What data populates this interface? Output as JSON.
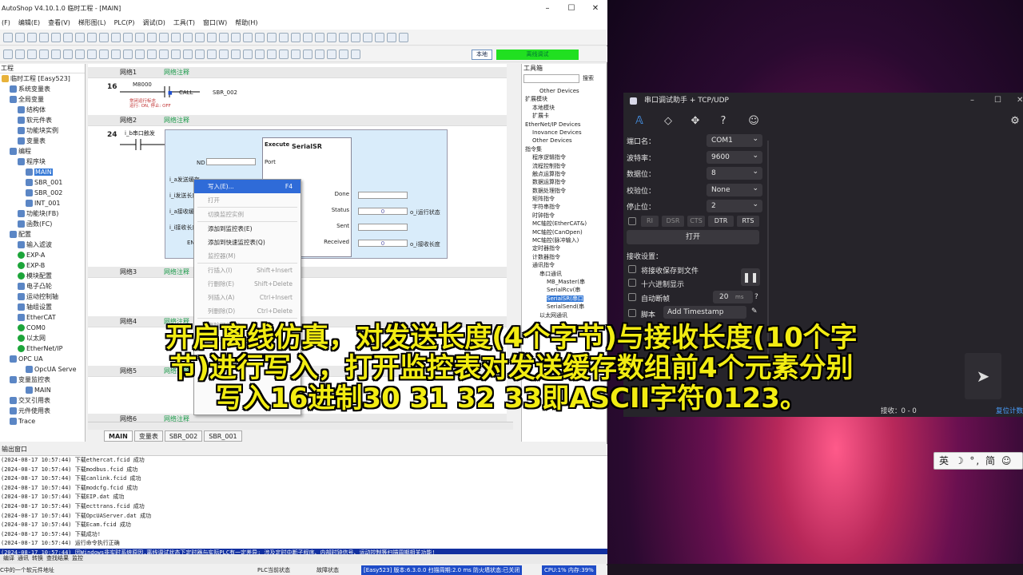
{
  "app": {
    "title": "AutoShop V4.10.1.0 临时工程 - [MAIN]",
    "min": "–",
    "max": "☐",
    "close": "✕"
  },
  "menu": [
    "(F)",
    "编辑(E)",
    "查看(V)",
    "梯形图(L)",
    "PLC(P)",
    "调试(D)",
    "工具(T)",
    "窗口(W)",
    "帮助(H)"
  ],
  "toolbar": {
    "local": "本地",
    "offline": "离线调试"
  },
  "tree": {
    "header": "工程",
    "items": [
      {
        "label": "临时工程 [Easy523]",
        "d": 0,
        "ic": "y"
      },
      {
        "label": "系统变量表",
        "d": 1,
        "ic": "b"
      },
      {
        "label": "全局变量",
        "d": 1,
        "ic": "b"
      },
      {
        "label": "结构体",
        "d": 2,
        "ic": "b"
      },
      {
        "label": "软元件表",
        "d": 2,
        "ic": "b"
      },
      {
        "label": "功能块实例",
        "d": 2,
        "ic": "b"
      },
      {
        "label": "变量表",
        "d": 2,
        "ic": "b"
      },
      {
        "label": "编程",
        "d": 1,
        "ic": "b"
      },
      {
        "label": "程序块",
        "d": 2,
        "ic": "b"
      },
      {
        "label": "MAIN",
        "d": 3,
        "ic": "b",
        "sel": true
      },
      {
        "label": "SBR_001",
        "d": 3,
        "ic": "b"
      },
      {
        "label": "SBR_002",
        "d": 3,
        "ic": "b"
      },
      {
        "label": "INT_001",
        "d": 3,
        "ic": "b"
      },
      {
        "label": "功能块(FB)",
        "d": 2,
        "ic": "b"
      },
      {
        "label": "函数(FC)",
        "d": 2,
        "ic": "b"
      },
      {
        "label": "配置",
        "d": 1,
        "ic": "b"
      },
      {
        "label": "输入滤波",
        "d": 2,
        "ic": "b"
      },
      {
        "label": "EXP-A",
        "d": 2,
        "ic": "g"
      },
      {
        "label": "EXP-B",
        "d": 2,
        "ic": "g"
      },
      {
        "label": "模块配置",
        "d": 2,
        "ic": "g"
      },
      {
        "label": "电子凸轮",
        "d": 2,
        "ic": "b"
      },
      {
        "label": "运动控制轴",
        "d": 2,
        "ic": "b"
      },
      {
        "label": "轴组设置",
        "d": 2,
        "ic": "b"
      },
      {
        "label": "EtherCAT",
        "d": 2,
        "ic": "b"
      },
      {
        "label": "COM0",
        "d": 2,
        "ic": "g"
      },
      {
        "label": "以太网",
        "d": 2,
        "ic": "g"
      },
      {
        "label": "EtherNet/IP",
        "d": 2,
        "ic": "g"
      },
      {
        "label": "OPC UA",
        "d": 1,
        "ic": "b"
      },
      {
        "label": "OpcUA Serve",
        "d": 3,
        "ic": "b"
      },
      {
        "label": "变量监控表",
        "d": 1,
        "ic": "b"
      },
      {
        "label": "MAIN",
        "d": 3,
        "ic": "b"
      },
      {
        "label": "交叉引用表",
        "d": 1,
        "ic": "b"
      },
      {
        "label": "元件使用表",
        "d": 1,
        "ic": "b"
      },
      {
        "label": "Trace",
        "d": 1,
        "ic": "b"
      }
    ]
  },
  "ladder": {
    "net1": {
      "title": "网络1",
      "comment": "网络注释",
      "rung": "16",
      "contact": "M8000",
      "note": "常闭运行标志\n运行: ON, 停止: OFF",
      "call": "CALL",
      "target": "SBR_002"
    },
    "net2": {
      "title": "网络2",
      "comment": "网络注释",
      "rung": "24",
      "contact": "i_b串口触发",
      "fb": "SerialSR",
      "execute": "Execute",
      "port": "Port",
      "done": "Done",
      "status": "Status",
      "sent": "Sent",
      "received": "Received",
      "in_nd": "ND",
      "in1": "i_a发送缓存",
      "in2": "i_i发送长度",
      "in3": "i_a接收缓存",
      "in4": "i_i接收长度",
      "in5": "EN",
      "status_val": "0",
      "recv_val": "0",
      "status_out": "o_i运行状态",
      "recv_out": "o_i接收长度"
    },
    "others": [
      {
        "title": "网络3",
        "comment": "网络注释"
      },
      {
        "title": "网络4",
        "comment": "网络注释"
      },
      {
        "title": "网络5",
        "comment": "网络注释"
      },
      {
        "title": "网络6",
        "comment": "网络注释"
      }
    ]
  },
  "tabs": [
    "MAIN",
    "变量表",
    "SBR_002",
    "SBR_001"
  ],
  "context": [
    {
      "label": "写入(E)...",
      "sc": "F4",
      "hl": true
    },
    {
      "label": "打开",
      "dis": true
    },
    {
      "sep": true
    },
    {
      "label": "切换监控实例",
      "dis": true
    },
    {
      "sep": true
    },
    {
      "label": "添加到监控表(E)"
    },
    {
      "label": "添加到快速监控表(Q)"
    },
    {
      "label": "监控器(M)",
      "dis": true
    },
    {
      "sep": true
    },
    {
      "label": "行插入(I)",
      "sc": "Shift+Insert",
      "dis": true
    },
    {
      "label": "行删除(E)",
      "sc": "Shift+Delete",
      "dis": true
    },
    {
      "label": "列插入(A)",
      "sc": "Ctrl+Insert",
      "dis": true
    },
    {
      "label": "列删除(D)",
      "sc": "Ctrl+Delete",
      "dis": true
    },
    {
      "sep": true
    },
    {
      "label": "删除网络(E)...",
      "dis": true
    },
    {
      "label": "插入执行块",
      "dis": true
    }
  ],
  "toolbox": {
    "title": "工具箱",
    "search": "搜索",
    "items": [
      {
        "l": "Other Devices",
        "d": 2
      },
      {
        "l": "扩展模块",
        "d": 0
      },
      {
        "l": "本地模块",
        "d": 1
      },
      {
        "l": "扩展卡",
        "d": 1
      },
      {
        "l": "EtherNet/IP Devices",
        "d": 0
      },
      {
        "l": "Inovance Devices",
        "d": 1
      },
      {
        "l": "Other Devices",
        "d": 1
      },
      {
        "l": "指令集",
        "d": 0
      },
      {
        "l": "程序逻辑指令",
        "d": 1
      },
      {
        "l": "流程控制指令",
        "d": 1
      },
      {
        "l": "触点运算指令",
        "d": 1
      },
      {
        "l": "数据运算指令",
        "d": 1
      },
      {
        "l": "数据处理指令",
        "d": 1
      },
      {
        "l": "矩阵指令",
        "d": 1
      },
      {
        "l": "字符串指令",
        "d": 1
      },
      {
        "l": "时钟指令",
        "d": 1
      },
      {
        "l": "MC轴控(EtherCAT&)",
        "d": 1
      },
      {
        "l": "MC轴控(CanOpen)",
        "d": 1
      },
      {
        "l": "MC轴控(脉冲输入)",
        "d": 1
      },
      {
        "l": "定时器指令",
        "d": 1
      },
      {
        "l": "计数器指令",
        "d": 1
      },
      {
        "l": "通讯指令",
        "d": 1
      },
      {
        "l": "串口通讯",
        "d": 2
      },
      {
        "l": "MB_Master(串",
        "d": 3
      },
      {
        "l": "SerialRcv(串",
        "d": 3
      },
      {
        "l": "SerialSR(串口",
        "d": 3,
        "sel": true
      },
      {
        "l": "SerialSend(串",
        "d": 3
      },
      {
        "l": "以太网通讯",
        "d": 2
      }
    ]
  },
  "output": {
    "title": "输出窗口",
    "lines": [
      "(2024-08-17 10:57:44)  下载ethercat.fcid 成功",
      "(2024-08-17 10:57:44)  下载modbus.fcid 成功",
      "(2024-08-17 10:57:44)  下载canlink.fcid 成功",
      "(2024-08-17 10:57:44)  下载modcfg.fcid 成功",
      "(2024-08-17 10:57:44)  下载EIP.dat 成功",
      "(2024-08-17 10:57:44)  下载ecttrans.fcid 成功",
      "(2024-08-17 10:57:44)  下载OpcUAServer.dat 成功",
      "(2024-08-17 10:57:44)  下载Ecam.fcid 成功",
      "(2024-08-17 10:57:44)  下载成功!",
      "(2024-08-17 10:57:44)  运行命令执行正确"
    ],
    "hi": "(2024-08-17 10:57:44)  因Windows非实时系统原因,离线调试状态下定时器与实际PLC有一定差异; 涉及定时中断子程序、内部时钟信号、运动控制等扫描周期相关功能!",
    "tabs": [
      "编译",
      "通讯",
      "转换",
      "查找结果",
      "监控"
    ]
  },
  "status": {
    "hint": "C中的一个软元件地址",
    "plc": "PLC当前状态",
    "fault": "故障状态",
    "plcinfo": "[Easy523] 版本:6.3.0.0 扫描周期:2.0 ms 防火墙状态:已关闭",
    "cpu": "CPU:1% 内存:39%"
  },
  "serial": {
    "title": "串口调试助手 + TCP/UDP",
    "port_k": "端口名：",
    "port_v": "COM1",
    "baud_k": "波特率：",
    "baud_v": "9600",
    "data_k": "数据位：",
    "data_v": "8",
    "parity_k": "校验位：",
    "parity_v": "None",
    "stop_k": "停止位：",
    "stop_v": "2",
    "pins": [
      "RI",
      "DSR",
      "CTS",
      "DTR",
      "RTS"
    ],
    "open": "打开",
    "recv_k": "接收设置：",
    "opt1": "将接收保存到文件",
    "opt2": "十六进制显示",
    "opt3": "自动断帧",
    "frame": "20",
    "ms": "ms",
    "help": "?",
    "opt4": "脚本",
    "ts": "Add Timestamp",
    "send_icon": "➤",
    "rx": "接收：0 - 0",
    "reset": "复位计数",
    "icons": [
      "𝔸",
      "◇",
      "✥",
      "?",
      "☺",
      "⚙"
    ]
  },
  "ime": "英 ☽ °, 简 ☺",
  "subtitle": [
    "开启离线仿真，对发送长度(4个字节)与接收长度(10个字",
    "节)进行写入，打开监控表对发送缓存数组前4个元素分别",
    "写入16进制30  31  32  33即ASCII字符0123。"
  ]
}
